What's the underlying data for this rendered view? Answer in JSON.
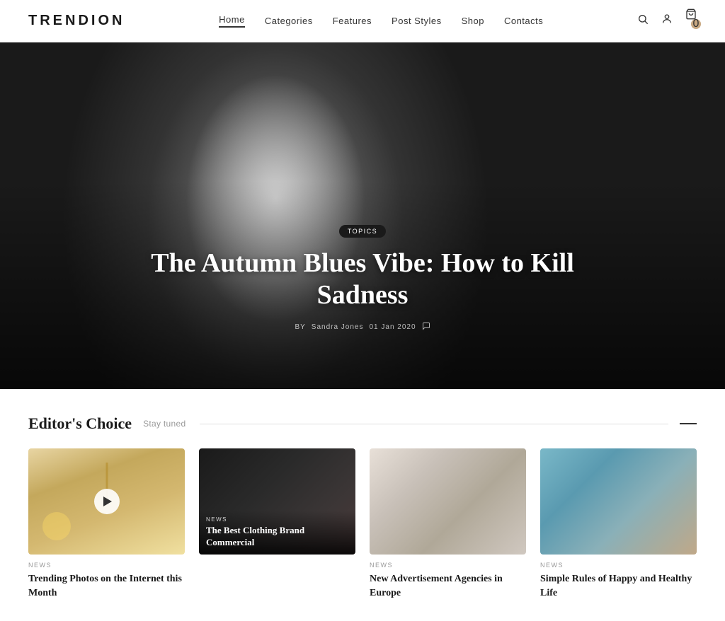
{
  "header": {
    "logo": "TRENDION",
    "nav": [
      {
        "label": "Home",
        "active": true
      },
      {
        "label": "Categories",
        "active": false
      },
      {
        "label": "Features",
        "active": false
      },
      {
        "label": "Post Styles",
        "active": false
      },
      {
        "label": "Shop",
        "active": false
      },
      {
        "label": "Contacts",
        "active": false
      }
    ],
    "icons": {
      "search": "🔍",
      "user": "👤",
      "cart": "🛒",
      "cart_count": "0"
    }
  },
  "hero": {
    "topic_badge": "TOPICS",
    "title": "The Autumn Blues Vibe: How to Kill Sadness",
    "author_prefix": "BY",
    "author": "Sandra Jones",
    "date": "01 Jan 2020",
    "comments_icon": "💬"
  },
  "editors_choice": {
    "title": "Editor's Choice",
    "subtitle": "Stay tuned",
    "cards": [
      {
        "category": "NEWS",
        "title": "Trending Photos on the Internet this Month",
        "has_play": true,
        "overlay": false
      },
      {
        "category": "NEWS",
        "title": "The Best Clothing Brand Commercial",
        "has_play": false,
        "overlay": true
      },
      {
        "category": "NEWS",
        "title": "New Advertisement Agencies in Europe",
        "has_play": false,
        "overlay": false
      },
      {
        "category": "NEWS",
        "title": "Simple Rules of Happy and Healthy Life",
        "has_play": false,
        "overlay": false
      }
    ]
  }
}
